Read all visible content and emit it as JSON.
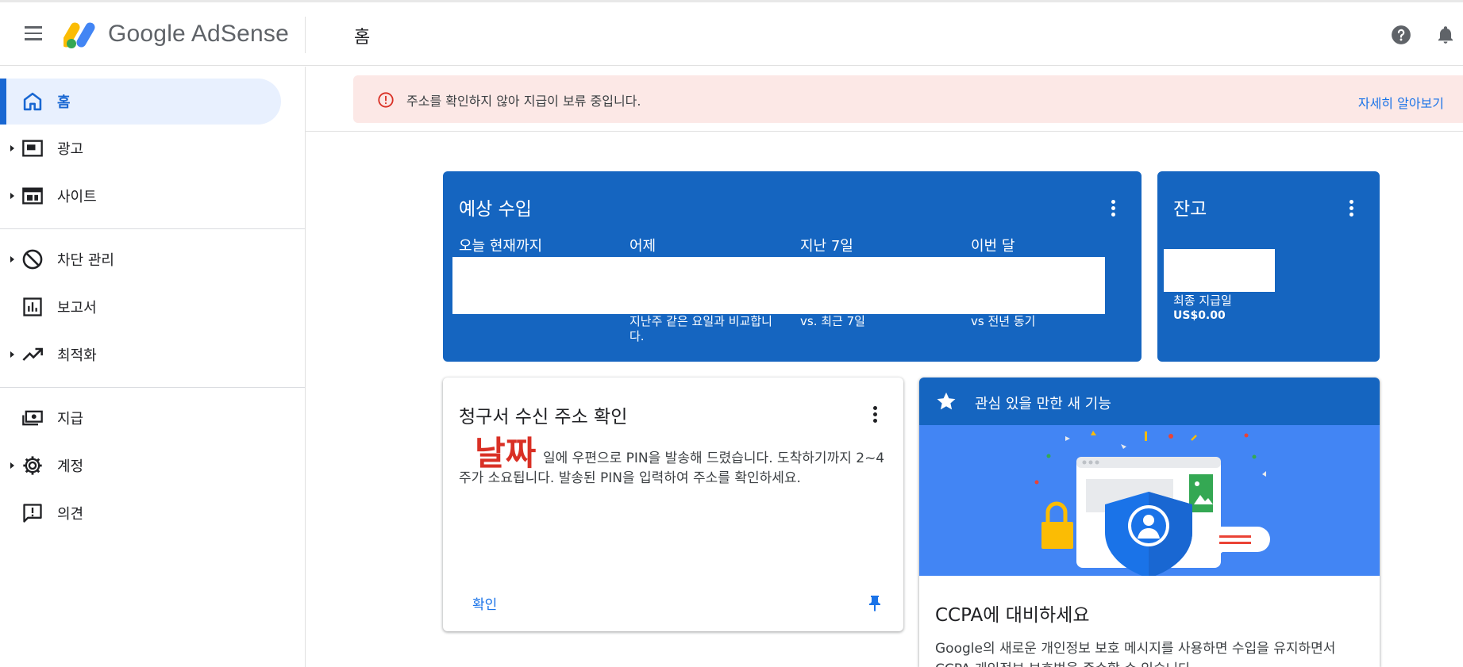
{
  "app": {
    "logo_text": "Google AdSense",
    "page_title": "홈"
  },
  "sidebar": {
    "items": [
      {
        "label": "홈",
        "icon": "home-icon",
        "active": true
      },
      {
        "label": "광고",
        "icon": "ads-icon"
      },
      {
        "label": "사이트",
        "icon": "sites-icon"
      },
      {
        "label": "차단 관리",
        "icon": "block-icon"
      },
      {
        "label": "보고서",
        "icon": "reports-icon"
      },
      {
        "label": "최적화",
        "icon": "trending-up-icon"
      },
      {
        "label": "지급",
        "icon": "payments-icon"
      },
      {
        "label": "계정",
        "icon": "gear-icon"
      },
      {
        "label": "의견",
        "icon": "feedback-icon"
      }
    ]
  },
  "alert": {
    "message": "주소를 확인하지 않아 지급이 보류 중입니다.",
    "link": "자세히 알아보기"
  },
  "earnings": {
    "title": "예상 수입",
    "periods": [
      {
        "label": "오늘 현재까지",
        "sub": ""
      },
      {
        "label": "어제",
        "sub": "지난주 같은 요일과 비교합니다."
      },
      {
        "label": "지난 7일",
        "sub": "vs. 최근 7일"
      },
      {
        "label": "이번 달",
        "sub": "vs 전년 동기"
      }
    ]
  },
  "balance": {
    "title": "잔고",
    "last_payment_label": "최종 지급일",
    "last_payment_amount": "US$0.00"
  },
  "address_card": {
    "title": "청구서 수신 주소 확인",
    "date_placeholder": "날짜",
    "body": "일에 우편으로 PIN을 발송해 드렸습니다. 도착하기까지 2~4주가 소요됩니다. 발송된 PIN을 입력하여 주소를 확인하세요.",
    "confirm_label": "확인"
  },
  "feature_card": {
    "header": "관심 있을 만한 새 기능",
    "title": "CCPA에 대비하세요",
    "body": "Google의 새로운 개인정보 보호 메시지를 사용하면 수입을 유지하면서 CCPA 개인정보 보호법을 준수할 수 있습니다."
  },
  "colors": {
    "primary_blue": "#1565c0",
    "link_blue": "#1a73e8",
    "alert_bg": "#fce8e6",
    "alert_red": "#d93025"
  }
}
